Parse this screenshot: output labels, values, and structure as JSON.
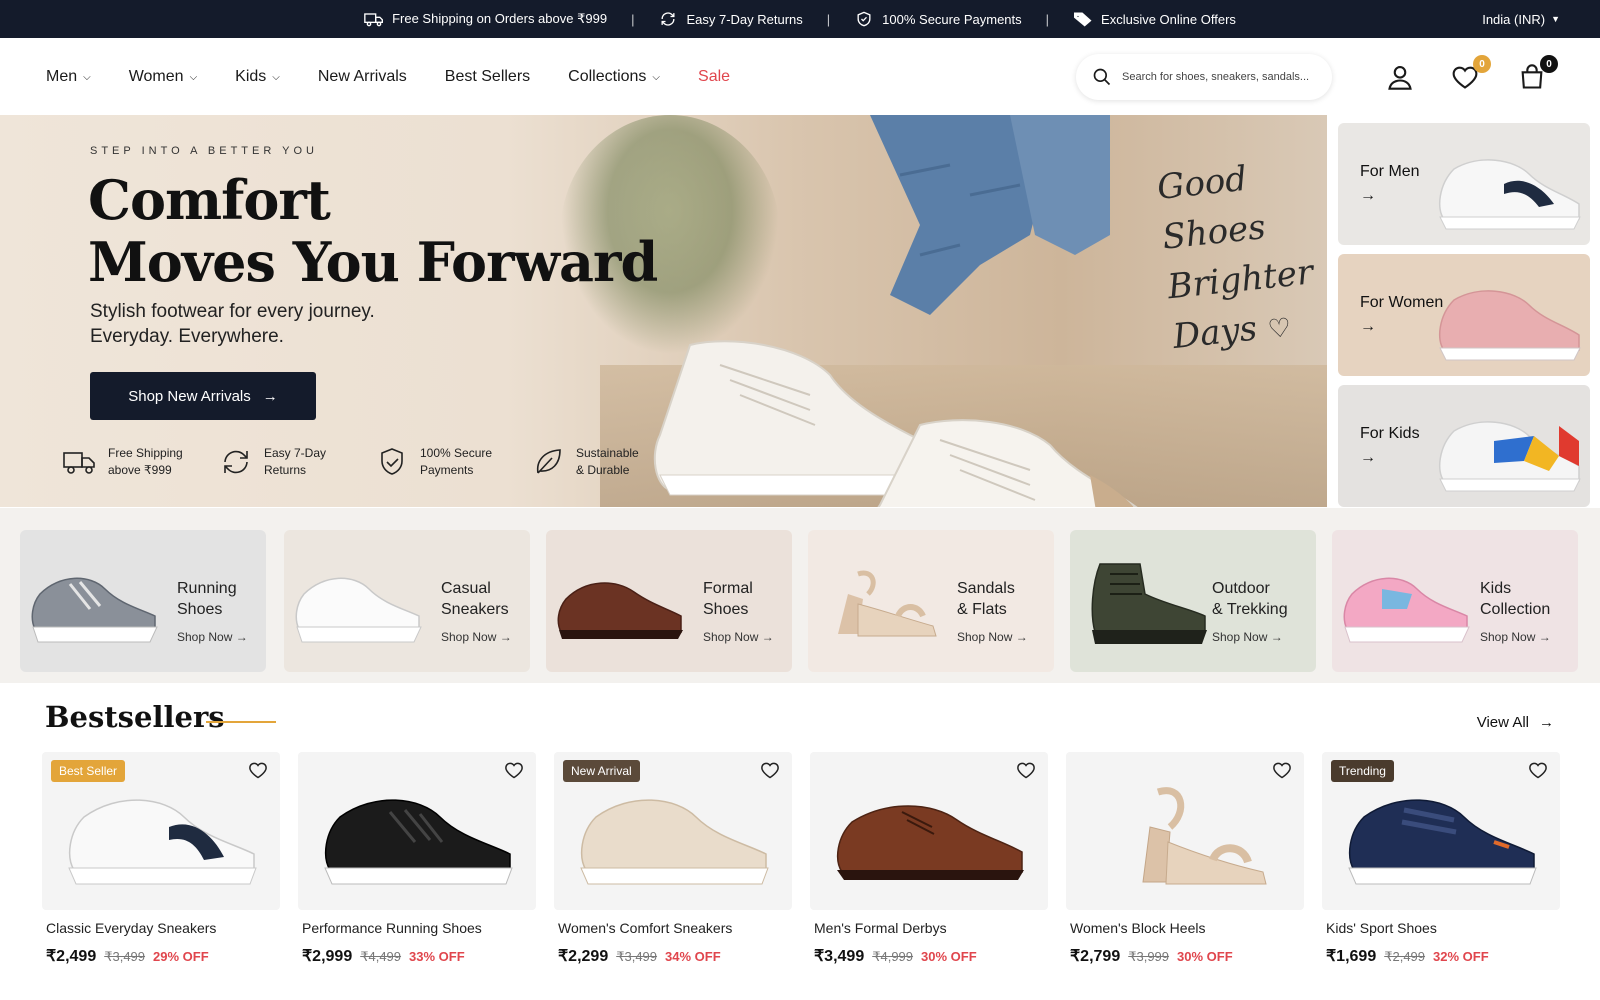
{
  "announcement": {
    "items": [
      {
        "icon": "truck-icon",
        "text": "Free Shipping on Orders above ₹999"
      },
      {
        "icon": "refresh-icon",
        "text": "Easy 7-Day Returns"
      },
      {
        "icon": "shield-check-icon",
        "text": "100% Secure Payments"
      },
      {
        "icon": "tag-icon",
        "text": "Exclusive Online Offers"
      }
    ],
    "separator": "|",
    "region": "India (INR)"
  },
  "nav": {
    "items": [
      {
        "label": "Men",
        "dropdown": true
      },
      {
        "label": "Women",
        "dropdown": true
      },
      {
        "label": "Kids",
        "dropdown": true
      },
      {
        "label": "New Arrivals",
        "dropdown": false
      },
      {
        "label": "Best Sellers",
        "dropdown": false
      },
      {
        "label": "Collections",
        "dropdown": true
      },
      {
        "label": "Sale",
        "dropdown": false
      }
    ],
    "sale_color": "#e0464d"
  },
  "search": {
    "placeholder": "Search for shoes, sneakers, sandals...",
    "value": ""
  },
  "header_icons": {
    "wishlist_count": "0",
    "cart_count": "0"
  },
  "hero": {
    "eyebrow": "STEP INTO A BETTER YOU",
    "title_line1": "Comfort",
    "title_line2": "Moves You Forward",
    "subtitle_line1": "Stylish footwear for every journey.",
    "subtitle_line2": "Everyday. Everywhere.",
    "cta_label": "Shop New Arrivals",
    "script_lines": [
      "Good",
      "Shoes",
      "Brighter",
      "Days"
    ],
    "features": [
      {
        "icon": "truck-icon",
        "line1": "Free Shipping",
        "line2": "above ₹999"
      },
      {
        "icon": "refresh-icon",
        "line1": "Easy 7-Day",
        "line2": "Returns"
      },
      {
        "icon": "shield-check-icon",
        "line1": "100% Secure",
        "line2": "Payments"
      },
      {
        "icon": "leaf-icon",
        "line1": "Sustainable",
        "line2": "& Durable"
      }
    ]
  },
  "side_categories": [
    {
      "label": "For Men",
      "arrow": "→",
      "bg": "#e9e7e4"
    },
    {
      "label": "For Women",
      "arrow": "→",
      "bg": "#e6d3c0"
    },
    {
      "label": "For Kids",
      "arrow": "→",
      "bg": "#e4e2e0"
    }
  ],
  "categories": [
    {
      "line1": "Running",
      "line2": "Shoes",
      "shop": "Shop Now →",
      "bg": "#e3e3e3"
    },
    {
      "line1": "Casual",
      "line2": "Sneakers",
      "shop": "Shop Now →",
      "bg": "#ece6df"
    },
    {
      "line1": "Formal",
      "line2": "Shoes",
      "shop": "Shop Now →",
      "bg": "#ebe1da"
    },
    {
      "line1": "Sandals",
      "line2": "& Flats",
      "shop": "Shop Now →",
      "bg": "#f2e9e3"
    },
    {
      "line1": "Outdoor",
      "line2": "& Trekking",
      "shop": "Shop Now →",
      "bg": "#dfe3d9"
    },
    {
      "line1": "Kids",
      "line2": "Collection",
      "shop": "Shop Now →",
      "bg": "#efe3e4"
    }
  ],
  "bestsellers": {
    "title": "Bestsellers",
    "view_all": "View All",
    "accent": "#e3a53a",
    "products": [
      {
        "name": "Classic Everyday Sneakers",
        "price": "₹2,499",
        "mrp": "₹3,499",
        "discount": "29% OFF",
        "tag": "Best Seller",
        "tag_color": "#e3a53a"
      },
      {
        "name": "Performance Running Shoes",
        "price": "₹2,999",
        "mrp": "₹4,499",
        "discount": "33% OFF",
        "tag": "",
        "tag_color": ""
      },
      {
        "name": "Women's Comfort Sneakers",
        "price": "₹2,299",
        "mrp": "₹3,499",
        "discount": "34% OFF",
        "tag": "New Arrival",
        "tag_color": "#5b4a3a"
      },
      {
        "name": "Men's Formal Derbys",
        "price": "₹3,499",
        "mrp": "₹4,999",
        "discount": "30% OFF",
        "tag": "",
        "tag_color": ""
      },
      {
        "name": "Women's Block Heels",
        "price": "₹2,799",
        "mrp": "₹3,999",
        "discount": "30% OFF",
        "tag": "",
        "tag_color": ""
      },
      {
        "name": "Kids' Sport Shoes",
        "price": "₹1,699",
        "mrp": "₹2,499",
        "discount": "32% OFF",
        "tag": "Trending",
        "tag_color": "#4a3b2d"
      }
    ]
  }
}
